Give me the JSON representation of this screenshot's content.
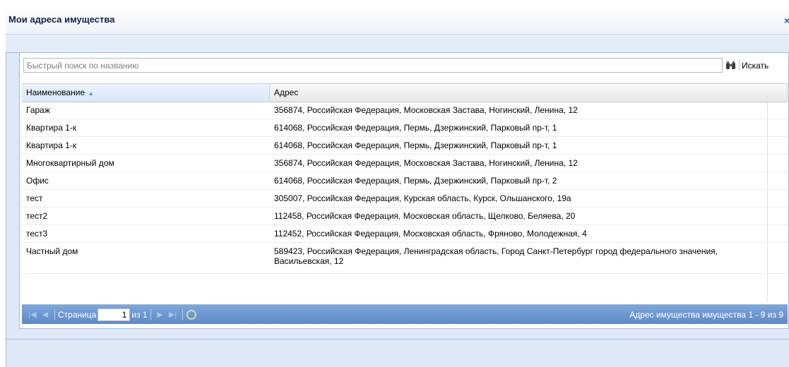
{
  "window": {
    "title": "Мои адреса имущества",
    "close_label": "×"
  },
  "search": {
    "placeholder": "Быстрый поиск по названию",
    "value": "",
    "button_label": "Искать",
    "button_icon": "binoculars-icon"
  },
  "grid": {
    "columns": [
      {
        "label": "Наименование",
        "sorted": "asc"
      },
      {
        "label": "Адрес"
      }
    ],
    "rows": [
      {
        "name": "Гараж",
        "address": "356874, Российская Федерация, Московская Застава, Ногинский, Ленина, 12"
      },
      {
        "name": "Квартира 1-к",
        "address": "614068, Российская Федерация, Пермь, Дзержинский, Парковый пр-т, 1"
      },
      {
        "name": "Квартира 1-к",
        "address": "614068, Российская Федерация, Пермь, Дзержинский, Парковый пр-т, 1"
      },
      {
        "name": "Многоквартирный дом",
        "address": "356874, Российская Федерация, Московская Застава, Ногинский, Ленина, 12"
      },
      {
        "name": "Офис",
        "address": "614068, Российская Федерация, Пермь, Дзержинский, Парковый пр-т, 2"
      },
      {
        "name": "тест",
        "address": "305007, Российская Федерация, Курская область, Курск, Ольшанского, 19а"
      },
      {
        "name": "тест2",
        "address": "112458, Российская Федерация, Московская область, Щелково, Беляева, 20"
      },
      {
        "name": "тест3",
        "address": "112452, Российская Федерация, Московская область, Фряново, Молодежная, 4"
      },
      {
        "name": "Частный дом",
        "address": "589423, Российская Федерация, Ленинградская область, Город Санкт-Петербург город федерального значения, Васильевская, 12"
      }
    ]
  },
  "pager": {
    "page_label": "Страница",
    "page_value": "1",
    "of_label": "из 1",
    "status": "Адрес имущества имущества 1 - 9 из 9",
    "icons": [
      "first-page-icon",
      "prev-page-icon",
      "next-page-icon",
      "last-page-icon",
      "refresh-icon"
    ]
  },
  "colors": {
    "accent": "#99bbe8",
    "pager_bg": "#6f98d0",
    "title_text": "#15224a"
  }
}
